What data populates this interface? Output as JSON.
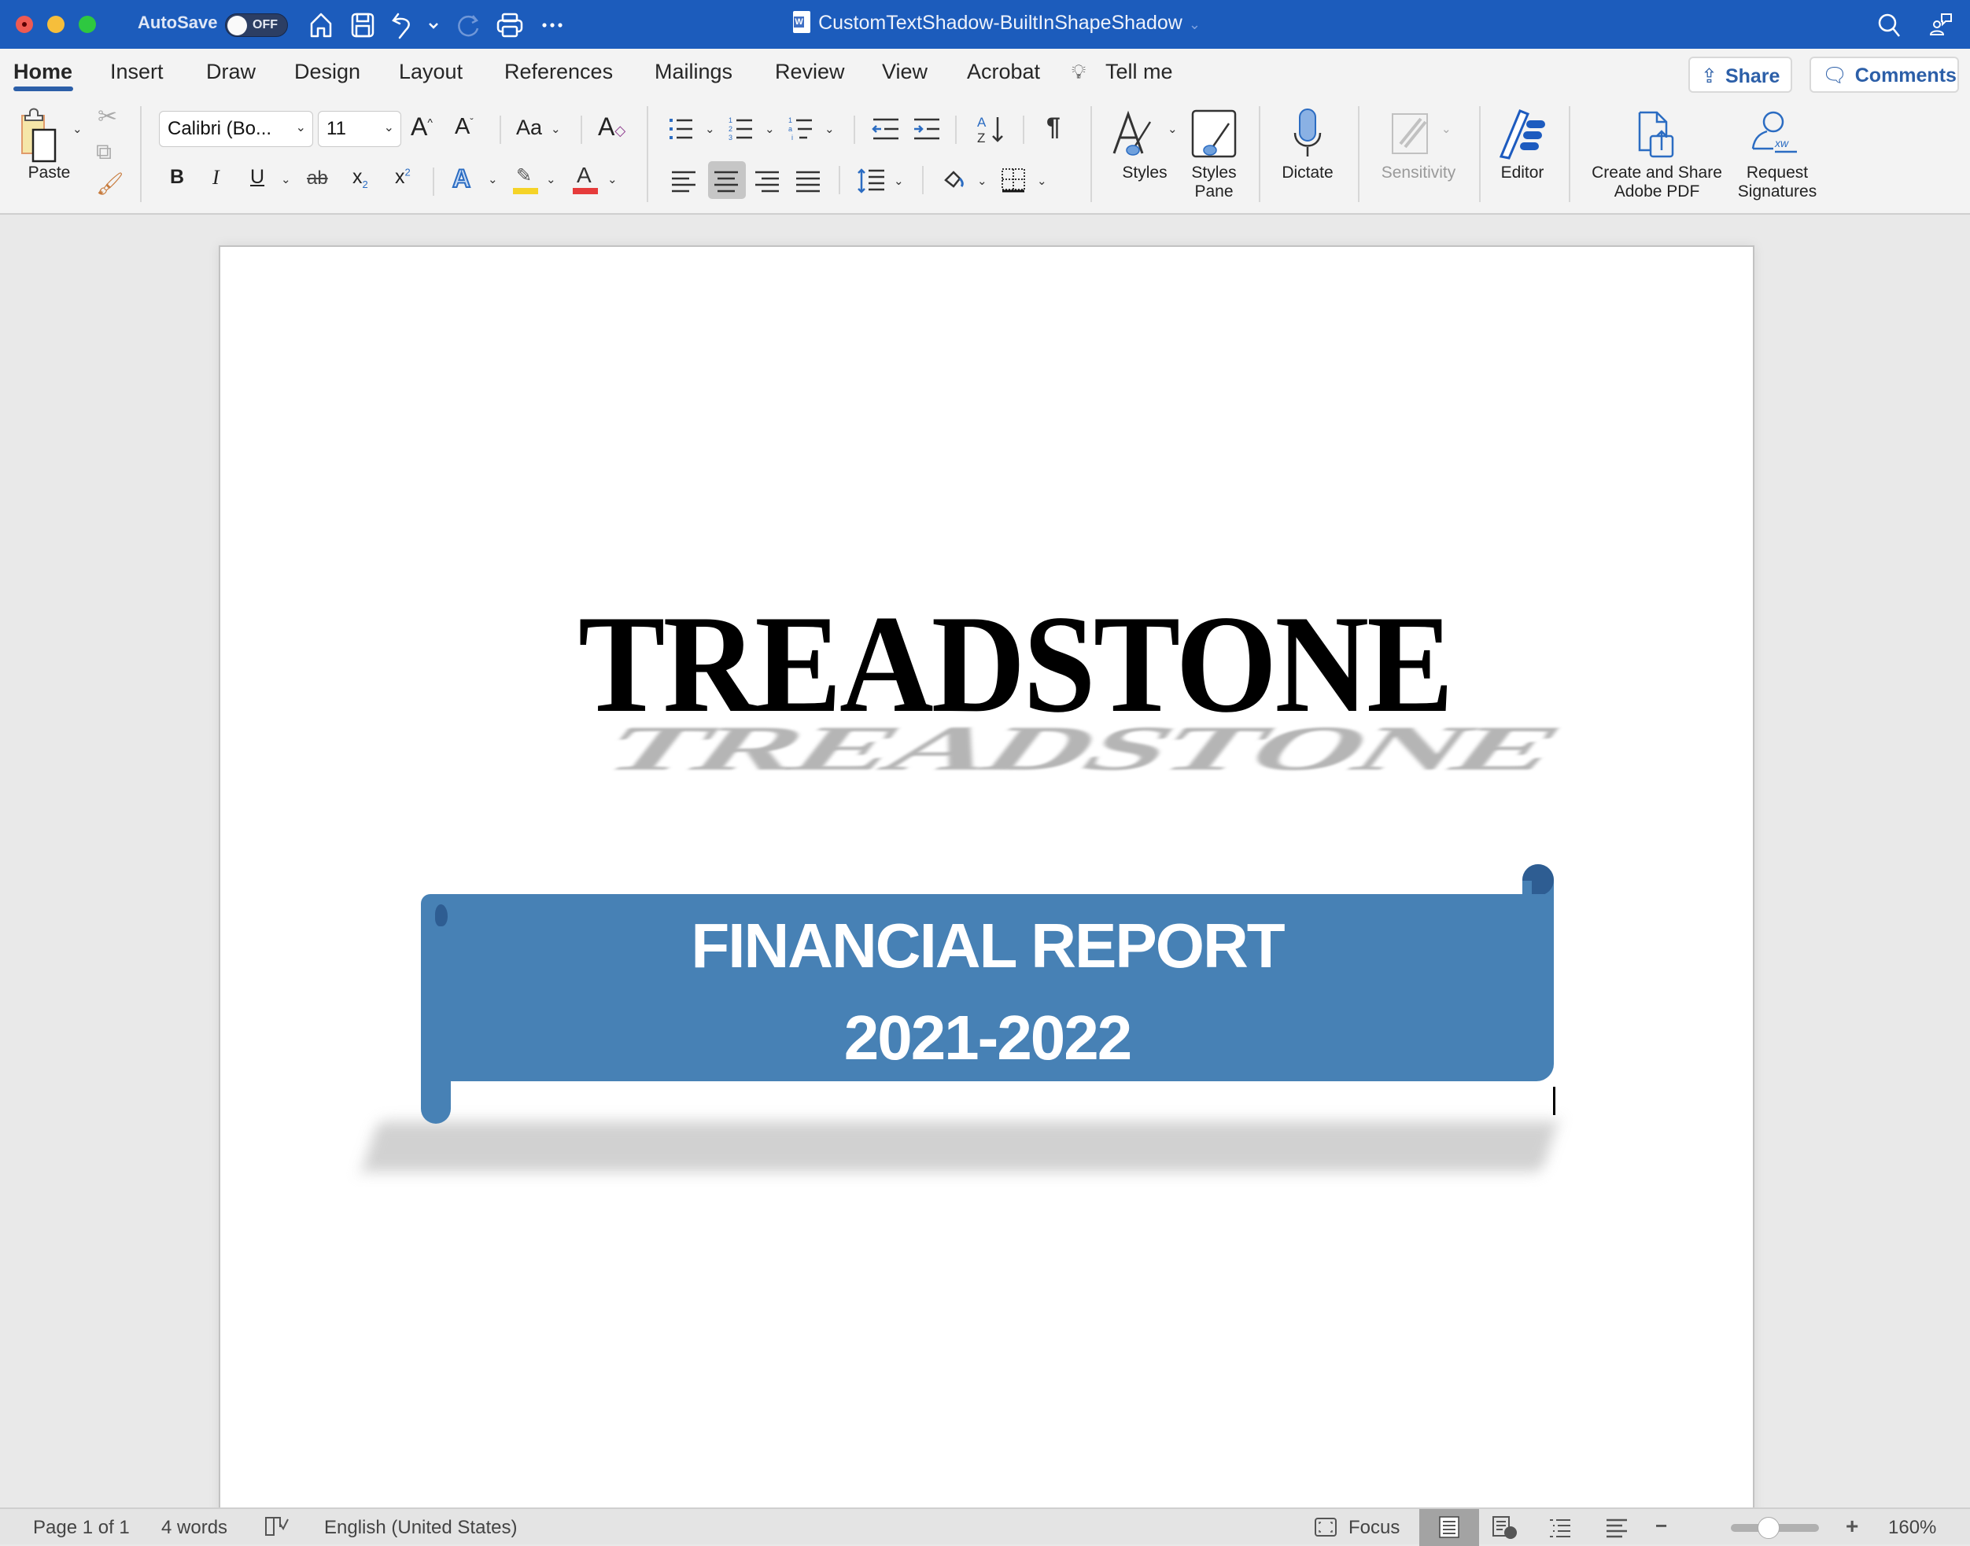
{
  "titlebar": {
    "autosave_label": "AutoSave",
    "autosave_state": "OFF",
    "document_title": "CustomTextShadow-BuiltInShapeShadow",
    "icons": [
      "home-icon",
      "save-icon",
      "undo-icon",
      "undo-dropdown-icon",
      "redo-icon",
      "print-icon",
      "more-icon",
      "search-icon",
      "share-people-icon"
    ]
  },
  "tabs": [
    {
      "label": "Home",
      "active": true
    },
    {
      "label": "Insert"
    },
    {
      "label": "Draw"
    },
    {
      "label": "Design"
    },
    {
      "label": "Layout"
    },
    {
      "label": "References"
    },
    {
      "label": "Mailings"
    },
    {
      "label": "Review"
    },
    {
      "label": "View"
    },
    {
      "label": "Acrobat"
    },
    {
      "label": "Tell me"
    }
  ],
  "header_buttons": {
    "share": "Share",
    "comments": "Comments"
  },
  "ribbon": {
    "paste_label": "Paste",
    "font_name": "Calibri (Bo...",
    "font_size": "11",
    "change_case": "Aa",
    "styles_label": "Styles",
    "styles_pane_label_1": "Styles",
    "styles_pane_label_2": "Pane",
    "dictate_label": "Dictate",
    "sensitivity_label": "Sensitivity",
    "editor_label": "Editor",
    "adobe_label_1": "Create and Share",
    "adobe_label_2": "Adobe PDF",
    "signatures_label_1": "Request",
    "signatures_label_2": "Signatures",
    "bold": "B",
    "italic": "I",
    "underline": "U",
    "strike": "ab",
    "subscript": "x",
    "superscript": "x",
    "highlight_color": "#f5d327",
    "font_color": "#e63b3b",
    "paragraph_mark": "¶"
  },
  "document": {
    "heading": "TREADSTONE",
    "banner_line1": "FINANCIAL REPORT",
    "banner_line2": "2021-2022",
    "banner_color": "#4781b5"
  },
  "statusbar": {
    "page": "Page 1 of 1",
    "words": "4 words",
    "language": "English (United States)",
    "focus": "Focus",
    "zoom_level": "160%",
    "zoom_percent": 160
  }
}
